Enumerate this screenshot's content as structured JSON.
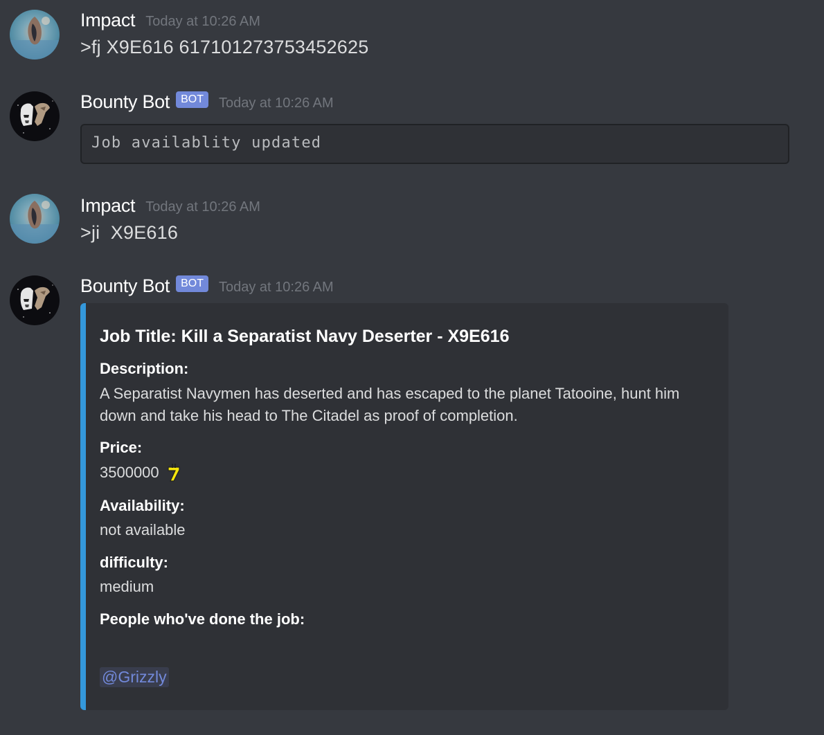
{
  "messages": [
    {
      "username": "Impact",
      "timestamp": "Today at 10:26 AM",
      "text": ">fj X9E616 617101273753452625"
    },
    {
      "username": "Bounty Bot",
      "bot_tag": "BOT",
      "timestamp": "Today at 10:26 AM",
      "code": "Job availablity updated"
    },
    {
      "username": "Impact",
      "timestamp": "Today at 10:26 AM",
      "text": ">ji  X9E616"
    },
    {
      "username": "Bounty Bot",
      "bot_tag": "BOT",
      "timestamp": "Today at 10:26 AM",
      "embed": {
        "accent_color": "#3498db",
        "title": "Job Title: Kill a Separatist Navy Deserter - X9E616",
        "description_name": "Description:",
        "description_value": "A Separatist Navymen has deserted and has escaped to the planet Tatooine, hunt him down and take his head to The Citadel as proof of completion.",
        "price_name": "Price:",
        "price_value": "3500000",
        "price_icon": "credits-icon",
        "availability_name": "Availability:",
        "availability_value": "not available",
        "difficulty_name": "difficulty:",
        "difficulty_value": "medium",
        "people_name": "People who've done the job:",
        "mention": "@Grizzly"
      }
    }
  ],
  "colors": {
    "background": "#36393f",
    "embed_background": "#2f3136",
    "bot_tag": "#7289da",
    "mention": "#7289da",
    "timestamp": "#72767d"
  }
}
